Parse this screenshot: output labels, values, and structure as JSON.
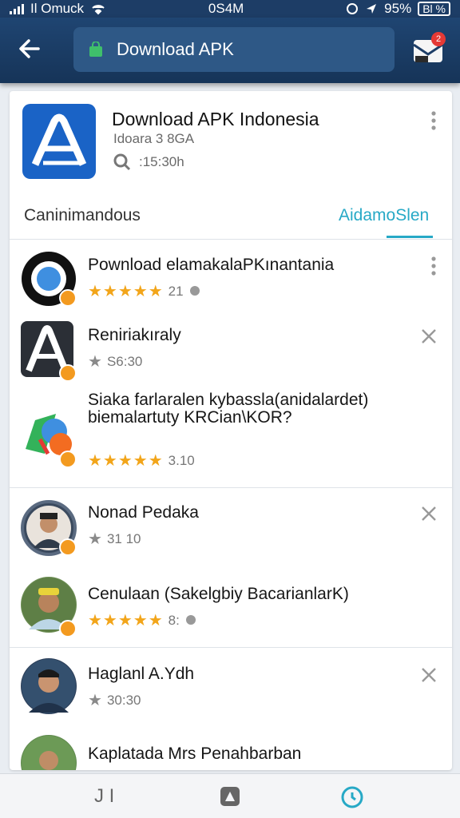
{
  "status": {
    "carrier": "Il Omuck",
    "time": "0S4M",
    "battery_pct": "95%",
    "battery": "Bl %"
  },
  "search": {
    "text": "Download APK"
  },
  "inbox": {
    "badge": "2"
  },
  "header": {
    "title": "Download APK Indonesia",
    "subtitle": "Idoara 3 8GA",
    "time": ":15:30h",
    "tab_left": "Caninimandous",
    "tab_right": "AidamoSlen"
  },
  "items": [
    {
      "name": "Pownload elamakalaPKınantania",
      "rating": "21",
      "icon": "search-app-icon"
    },
    {
      "name": "Reniriakıraly",
      "rating": "S6:30",
      "icon": "a-letter-app-icon"
    },
    {
      "name": "Siaka farlaralen kybassla(anidalardet) biemalartuty KRCian\\KOR?",
      "rating": "3.10",
      "icon": "maps-app-icon"
    },
    {
      "name": "Nonad Pedaka",
      "rating": "31 10",
      "icon": "user-avatar"
    },
    {
      "name": "Cenulaan (Sakelgbiy BacarianlarK)",
      "rating": "8:",
      "icon": "user-avatar"
    },
    {
      "name": "Haglanl A.Ydh",
      "rating": "30:30",
      "icon": "user-avatar"
    },
    {
      "name": "Kaplatada Mrs Penahbarban",
      "rating": "",
      "icon": "user-avatar"
    }
  ],
  "bottom_nav": {
    "left_label": "J I"
  },
  "colors": {
    "appbar": "#1f4572",
    "accent": "#27a9c6",
    "star": "#f2a51a",
    "badge": "#f39a1f"
  }
}
